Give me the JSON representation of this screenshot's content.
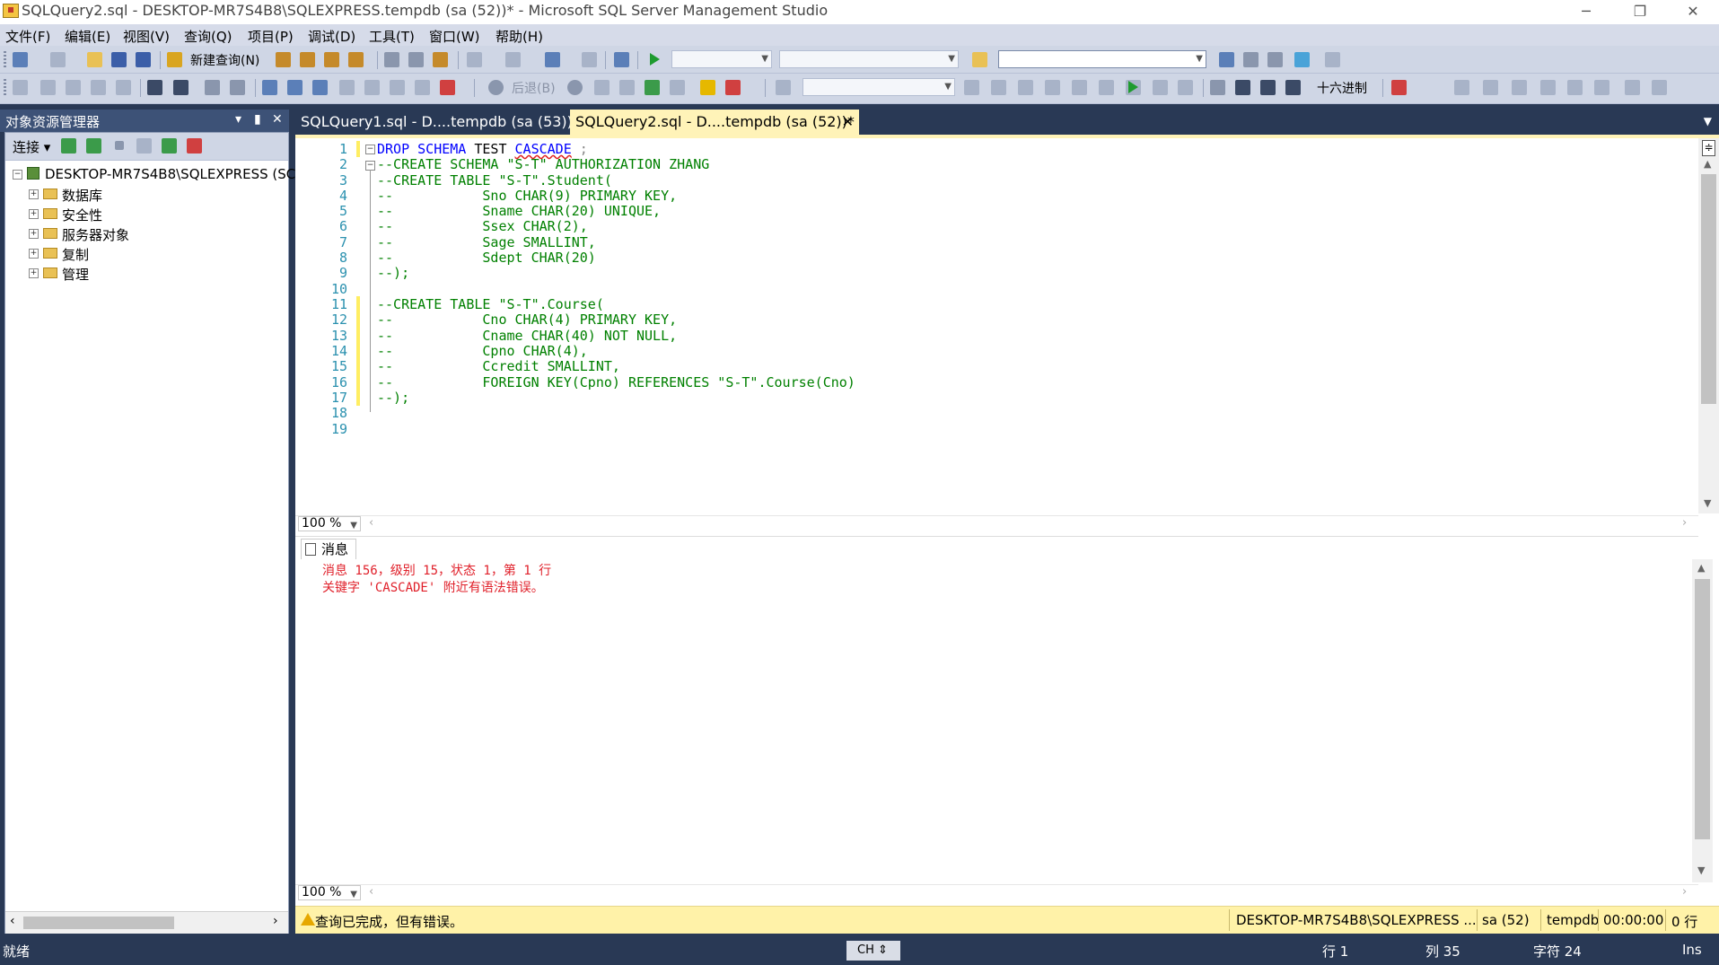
{
  "window": {
    "title": "SQLQuery2.sql - DESKTOP-MR7S4B8\\SQLEXPRESS.tempdb (sa (52))* - Microsoft SQL Server Management Studio"
  },
  "menu": [
    "文件(F)",
    "编辑(E)",
    "视图(V)",
    "查询(Q)",
    "项目(P)",
    "调试(D)",
    "工具(T)",
    "窗口(W)",
    "帮助(H)"
  ],
  "toolbar": {
    "new_query_label": "新建查询(N)",
    "back_label": "后退(B)",
    "hex_label": "十六进制"
  },
  "object_explorer": {
    "title": "对象资源管理器",
    "connect_label": "连接",
    "root": "DESKTOP-MR7S4B8\\SQLEXPRESS (SC",
    "nodes": [
      "数据库",
      "安全性",
      "服务器对象",
      "复制",
      "管理"
    ]
  },
  "tabs": [
    {
      "label": "SQLQuery1.sql - D....tempdb (sa (53))"
    },
    {
      "label": "SQLQuery2.sql - D....tempdb (sa (52))*"
    }
  ],
  "editor": {
    "line_numbers": [
      "1",
      "2",
      "3",
      "4",
      "5",
      "6",
      "7",
      "8",
      "9",
      "10",
      "11",
      "12",
      "13",
      "14",
      "15",
      "16",
      "17",
      "18",
      "19"
    ],
    "lines": [
      "DROP SCHEMA TEST CASCADE ;",
      "--CREATE SCHEMA \"S-T\" AUTHORIZATION ZHANG",
      "--CREATE TABLE \"S-T\".Student(",
      "--           Sno CHAR(9) PRIMARY KEY,",
      "--           Sname CHAR(20) UNIQUE,",
      "--           Ssex CHAR(2),",
      "--           Sage SMALLINT,",
      "--           Sdept CHAR(20)",
      "--);",
      "",
      "--CREATE TABLE \"S-T\".Course(",
      "--           Cno CHAR(4) PRIMARY KEY,",
      "--           Cname CHAR(40) NOT NULL,",
      "--           Cpno CHAR(4),",
      "--           Ccredit SMALLINT,",
      "--           FOREIGN KEY(Cpno) REFERENCES \"S-T\".Course(Cno)",
      "--);",
      "",
      ""
    ],
    "line1_tokens": {
      "kw1": "DROP",
      "kw2": "SCHEMA",
      "name": "TEST",
      "err": "CASCADE",
      "end": ";"
    },
    "zoom": "100 %"
  },
  "results": {
    "tab_label": "消息",
    "messages": [
      "消息 156，级别 15，状态 1，第 1 行",
      "关键字 'CASCADE' 附近有语法错误。"
    ],
    "zoom": "100 %"
  },
  "query_status": {
    "message": "查询已完成，但有错误。",
    "server": "DESKTOP-MR7S4B8\\SQLEXPRESS ...",
    "user": "sa (52)",
    "database": "tempdb",
    "elapsed": "00:00:00",
    "rows": "0 行"
  },
  "statusbar": {
    "ready": "就绪",
    "ime": "CH",
    "line": "行 1",
    "col": "列 35",
    "char": "字符 24",
    "mode": "Ins"
  },
  "colors": {
    "accent": "#293955",
    "keyword": "#0000ff",
    "comment": "#008000",
    "error": "#e0202a",
    "line_number": "#2b91af",
    "status_yellow": "#fff2a8"
  }
}
